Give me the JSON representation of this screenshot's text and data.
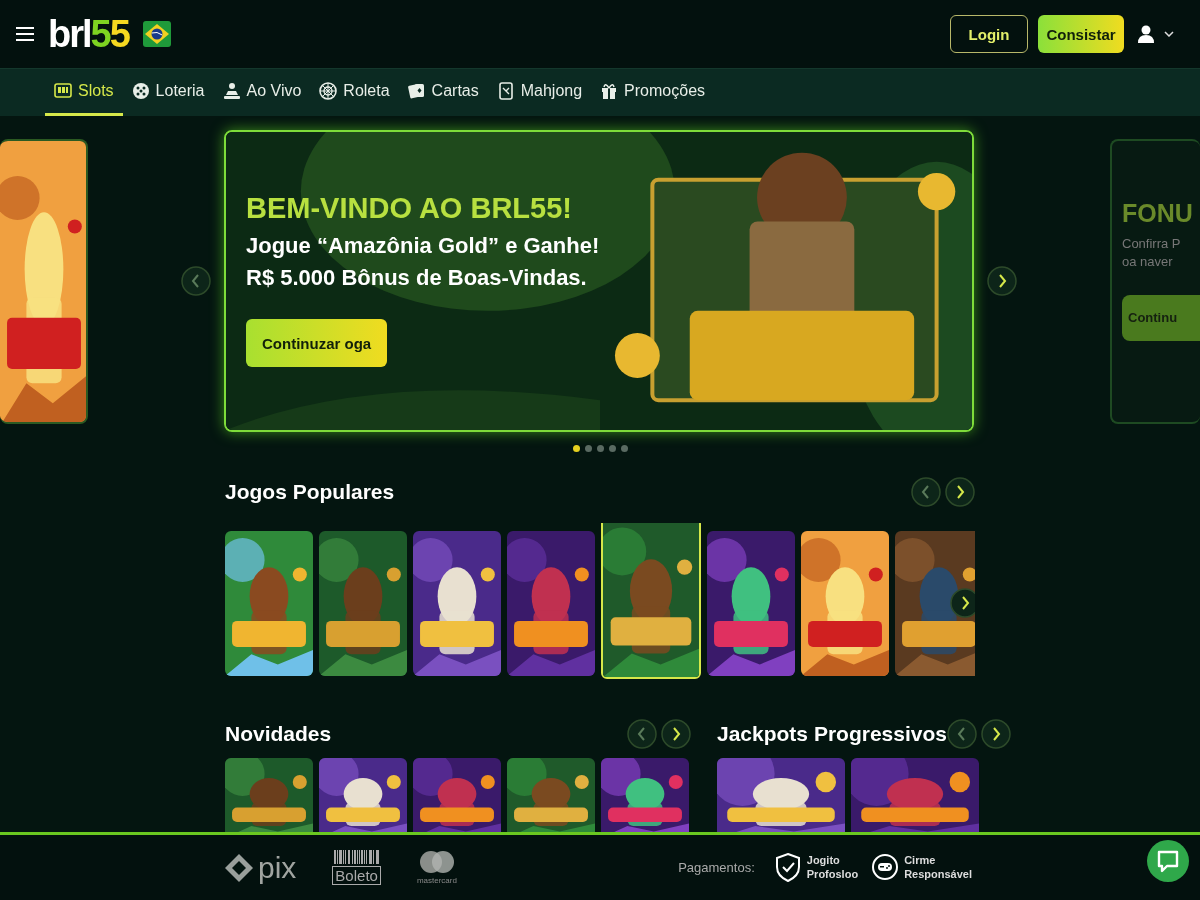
{
  "header": {
    "logo": {
      "part_1": "brl",
      "part_2": "5",
      "part_3": "5"
    },
    "login_button": "Login",
    "register_button": "Consistar"
  },
  "nav": [
    {
      "label": "Slots",
      "selected": true
    },
    {
      "label": "Loteria",
      "selected": false
    },
    {
      "label": "Ao Vivo",
      "selected": false
    },
    {
      "label": "Roleta",
      "selected": false
    },
    {
      "label": "Cartas",
      "selected": false
    },
    {
      "label": "Mahjong",
      "selected": false
    },
    {
      "label": "Promoções",
      "selected": false
    }
  ],
  "banner": {
    "title": "BEM-VINDO AO BRL55!",
    "line_1": "Jogue “Amazônia Gold” e Ganhe!",
    "line_2": "R$ 5.000 Bônus de Boas-Vindas.",
    "button": "Continuzar oga",
    "next_card": {
      "title": "FONU",
      "line_1": "Confirra P",
      "line_2": "oa naver",
      "button": "Continu"
    },
    "dots": [
      {
        "selected": true
      },
      {
        "selected": false
      },
      {
        "selected": false
      },
      {
        "selected": false
      },
      {
        "selected": false
      }
    ]
  },
  "popular": {
    "title": "Jogos Populares",
    "games": [
      {
        "kind": "picture",
        "selected": false
      },
      {
        "kind": "picture",
        "selected": false
      },
      {
        "kind": "picture",
        "selected": false
      },
      {
        "kind": "picture",
        "selected": false
      },
      {
        "kind": "picture",
        "selected": true
      },
      {
        "kind": "picture",
        "selected": false
      },
      {
        "kind": "picture",
        "selected": false
      },
      {
        "kind": "picture",
        "selected": false
      }
    ]
  },
  "new_games": {
    "title": "Novidades",
    "games": [
      {
        "kind": "picture"
      },
      {
        "kind": "picture"
      },
      {
        "kind": "picture"
      },
      {
        "kind": "picture"
      },
      {
        "kind": "picture"
      }
    ]
  },
  "jackpots": {
    "title": "Jackpots Progressivos",
    "games": [
      {
        "kind": "picture"
      },
      {
        "kind": "picture"
      }
    ]
  },
  "footer": {
    "pix": "pix",
    "boleto": "Boleto",
    "mastercard": "mastercard",
    "payments_label": "Pagamentos:",
    "badges": [
      {
        "line_1": "Jogito",
        "line_2": "Profosloo"
      },
      {
        "line_1": "Cirme",
        "line_2": "Responsável"
      }
    ]
  }
}
